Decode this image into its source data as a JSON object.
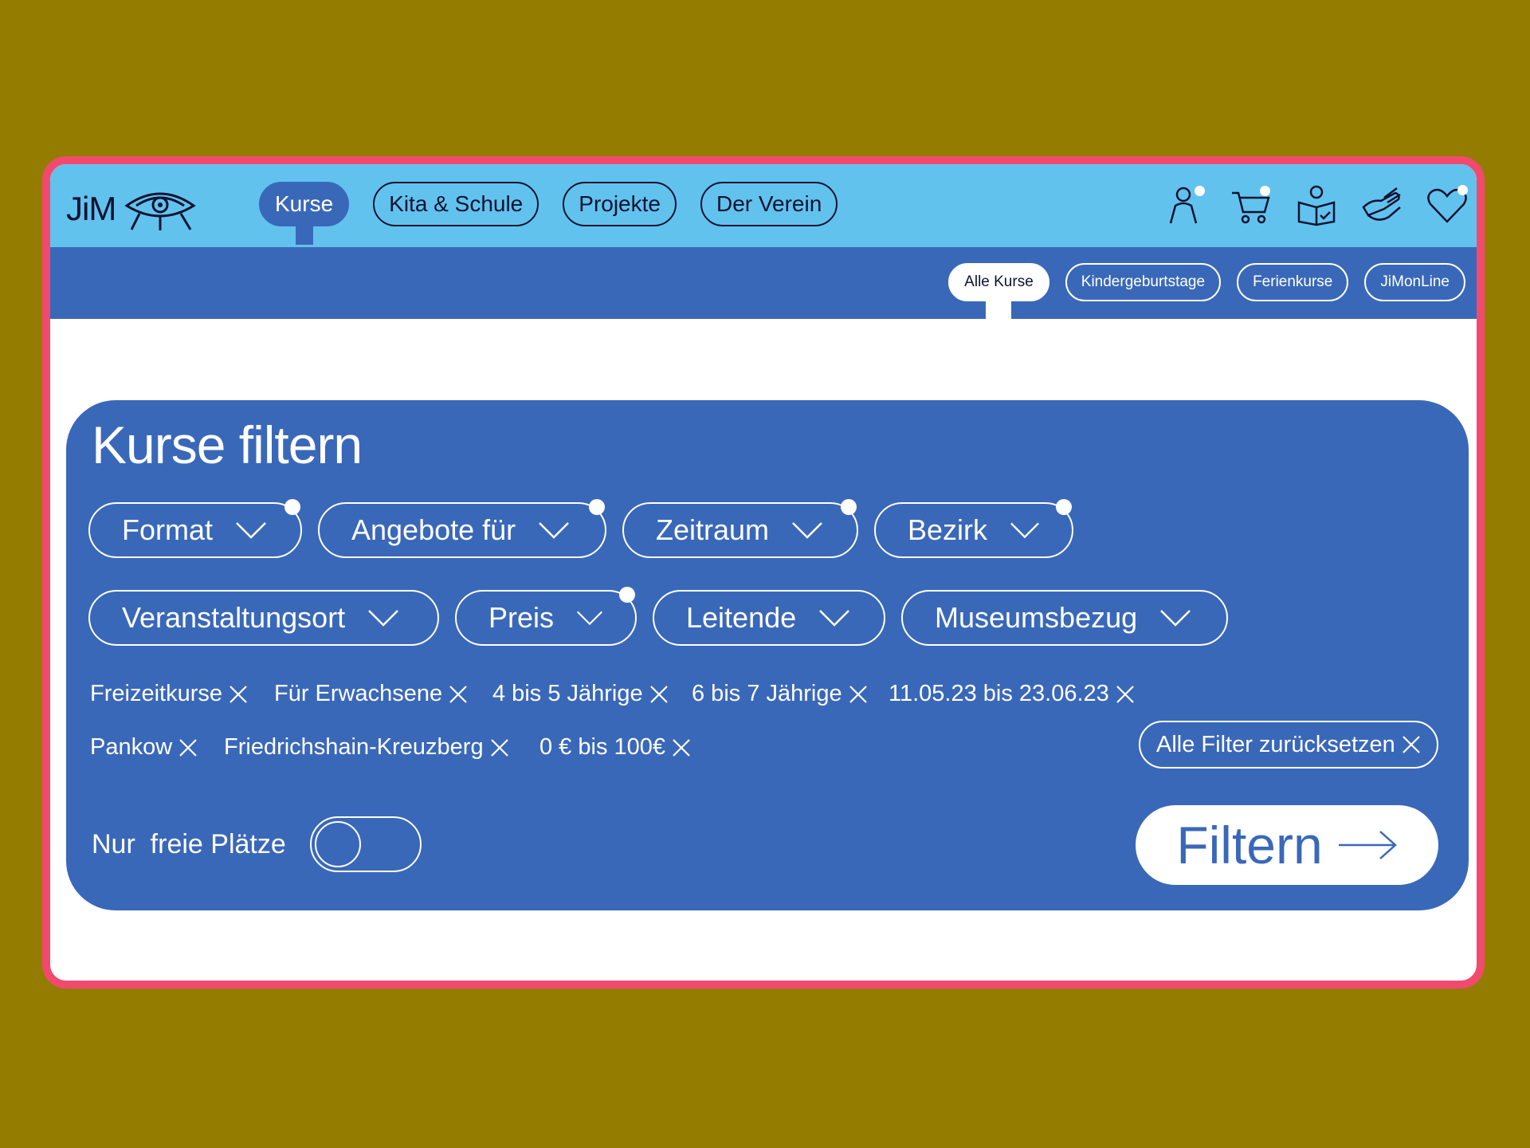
{
  "brand": {
    "logo_text": "JiM"
  },
  "nav": {
    "items": [
      {
        "label": "Kurse",
        "active": true
      },
      {
        "label": "Kita & Schule",
        "active": false
      },
      {
        "label": "Projekte",
        "active": false
      },
      {
        "label": "Der Verein",
        "active": false
      }
    ],
    "icons": [
      "user-icon",
      "cart-icon",
      "reading-icon",
      "handshake-icon",
      "heart-icon"
    ]
  },
  "subnav": {
    "items": [
      {
        "label": "Alle Kurse",
        "active": true
      },
      {
        "label": "Kindergeburtstage",
        "active": false
      },
      {
        "label": "Ferienkurse",
        "active": false
      },
      {
        "label": "JiMonLine",
        "active": false
      }
    ]
  },
  "filter": {
    "title": "Kurse filtern",
    "dropdowns_row1": [
      {
        "label": "Format",
        "has_selection": true
      },
      {
        "label": "Angebote für",
        "has_selection": true
      },
      {
        "label": "Zeitraum",
        "has_selection": true
      },
      {
        "label": "Bezirk",
        "has_selection": true
      }
    ],
    "dropdowns_row2": [
      {
        "label": "Veranstaltungsort",
        "has_selection": false
      },
      {
        "label": "Preis",
        "has_selection": true
      },
      {
        "label": "Leitende",
        "has_selection": false
      },
      {
        "label": "Museumsbezug",
        "has_selection": false
      }
    ],
    "chips_row1": [
      "Freizeitkurse",
      "Für Erwachsene",
      "4 bis 5 Jährige",
      "6 bis 7 Jährige",
      "11.05.23 bis 23.06.23"
    ],
    "chips_row2": [
      "Pankow",
      "Friedrichshain-Kreuzberg",
      "0 € bis 100€"
    ],
    "reset_label": "Alle Filter zurücksetzen",
    "free_places_label": "Nur  freie Plätze",
    "free_places_on": false,
    "submit_label": "Filtern"
  },
  "colors": {
    "background": "#937c00",
    "frame": "#f24a6e",
    "top_bar": "#62c2ee",
    "primary_blue": "#3a68b9",
    "ink": "#0b1330"
  }
}
